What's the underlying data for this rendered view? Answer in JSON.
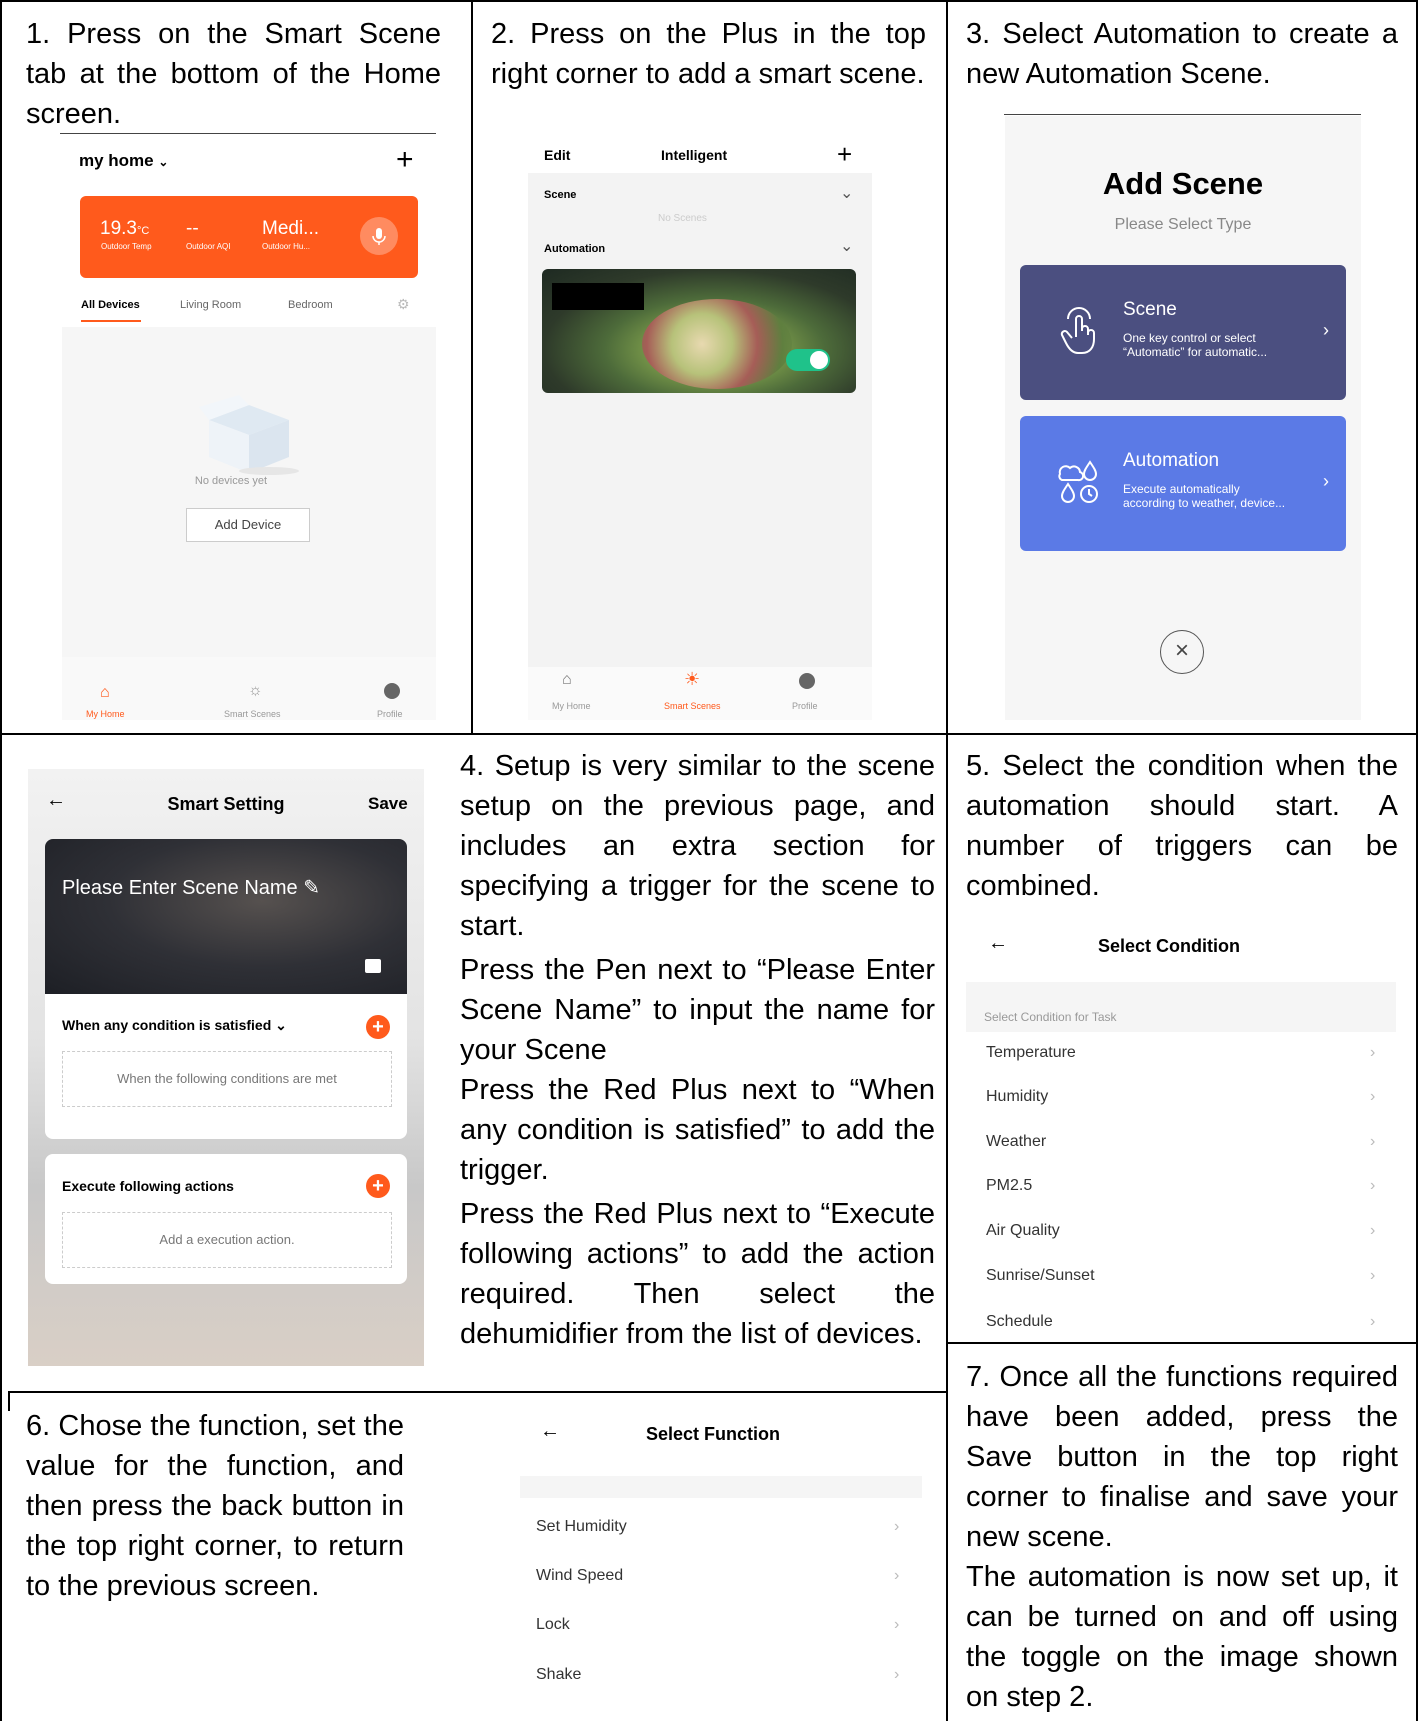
{
  "steps": {
    "s1": "1. Press on the Smart Scene tab at the bottom of the Home screen.",
    "s2": "2. Press on the Plus in the top right corner to add a smart scene.",
    "s3": "3. Select Automation to create a new Automation Scene.",
    "s4": [
      "4. Setup is very similar to the scene setup on the previous page, and includes an extra section for specifying a trigger for the scene to start.",
      "Press the Pen next to “Please Enter Scene Name” to input the name for your Scene",
      "Press the Red Plus next to “When any condition is satisfied” to add the trigger.",
      "Press the Red Plus next to “Execute following actions” to add the action required. Then select the dehumidifier from the list of devices."
    ],
    "s5": "5. Select the condition when the automation should start. A number of triggers can be combined.",
    "s6": "6. Chose the function, set the value for the function, and then press the back button in the top right corner, to return to the previous screen.",
    "s7": [
      "7. Once all the functions required have been added, press the Save button in the top right corner to finalise and save your new scene.",
      "The automation is now set up, it can be turned on and off using the toggle on the image shown on step 2."
    ]
  },
  "home": {
    "title": "my home",
    "temp": "19.3",
    "temp_unit": "°C",
    "aqi": "--",
    "humidity": "Medi...",
    "temp_label": "Outdoor Temp",
    "aqi_label": "Outdoor AQI",
    "hum_label": "Outdoor Hu...",
    "tabs": [
      "All Devices",
      "Living Room",
      "Bedroom"
    ],
    "empty": "No devices yet",
    "add_device": "Add Device",
    "nav": [
      "My Home",
      "Smart Scenes",
      "Profile"
    ]
  },
  "intelligent": {
    "edit": "Edit",
    "title": "Intelligent",
    "scene": "Scene",
    "no_scenes": "No Scenes",
    "automation": "Automation",
    "nav": [
      "My Home",
      "Smart Scenes",
      "Profile"
    ]
  },
  "add_scene": {
    "title": "Add Scene",
    "subtitle": "Please Select Type",
    "scene_title": "Scene",
    "scene_desc1": "One key control or select",
    "scene_desc2": "“Automatic” for automatic...",
    "auto_title": "Automation",
    "auto_desc1": "Execute automatically",
    "auto_desc2": "according to weather, device..."
  },
  "smart_setting": {
    "title": "Smart Setting",
    "save": "Save",
    "name_placeholder": "Please Enter Scene Name",
    "condition_header": "When any condition is satisfied",
    "condition_hint": "When the following conditions are met",
    "actions_header": "Execute following actions",
    "actions_hint": "Add a execution action."
  },
  "select_condition": {
    "title": "Select Condition",
    "section": "Select Condition for Task",
    "items": [
      "Temperature",
      "Humidity",
      "Weather",
      "PM2.5",
      "Air Quality",
      "Sunrise/Sunset",
      "Schedule"
    ]
  },
  "select_function": {
    "title": "Select Function",
    "items": [
      "Set Humidity",
      "Wind Speed",
      "Lock",
      "Shake"
    ]
  },
  "colors": {
    "orange": "#ff5a1c",
    "scene_card": "#4b4f80",
    "automation_card": "#5b7ae6",
    "toggle": "#1fc28a"
  }
}
